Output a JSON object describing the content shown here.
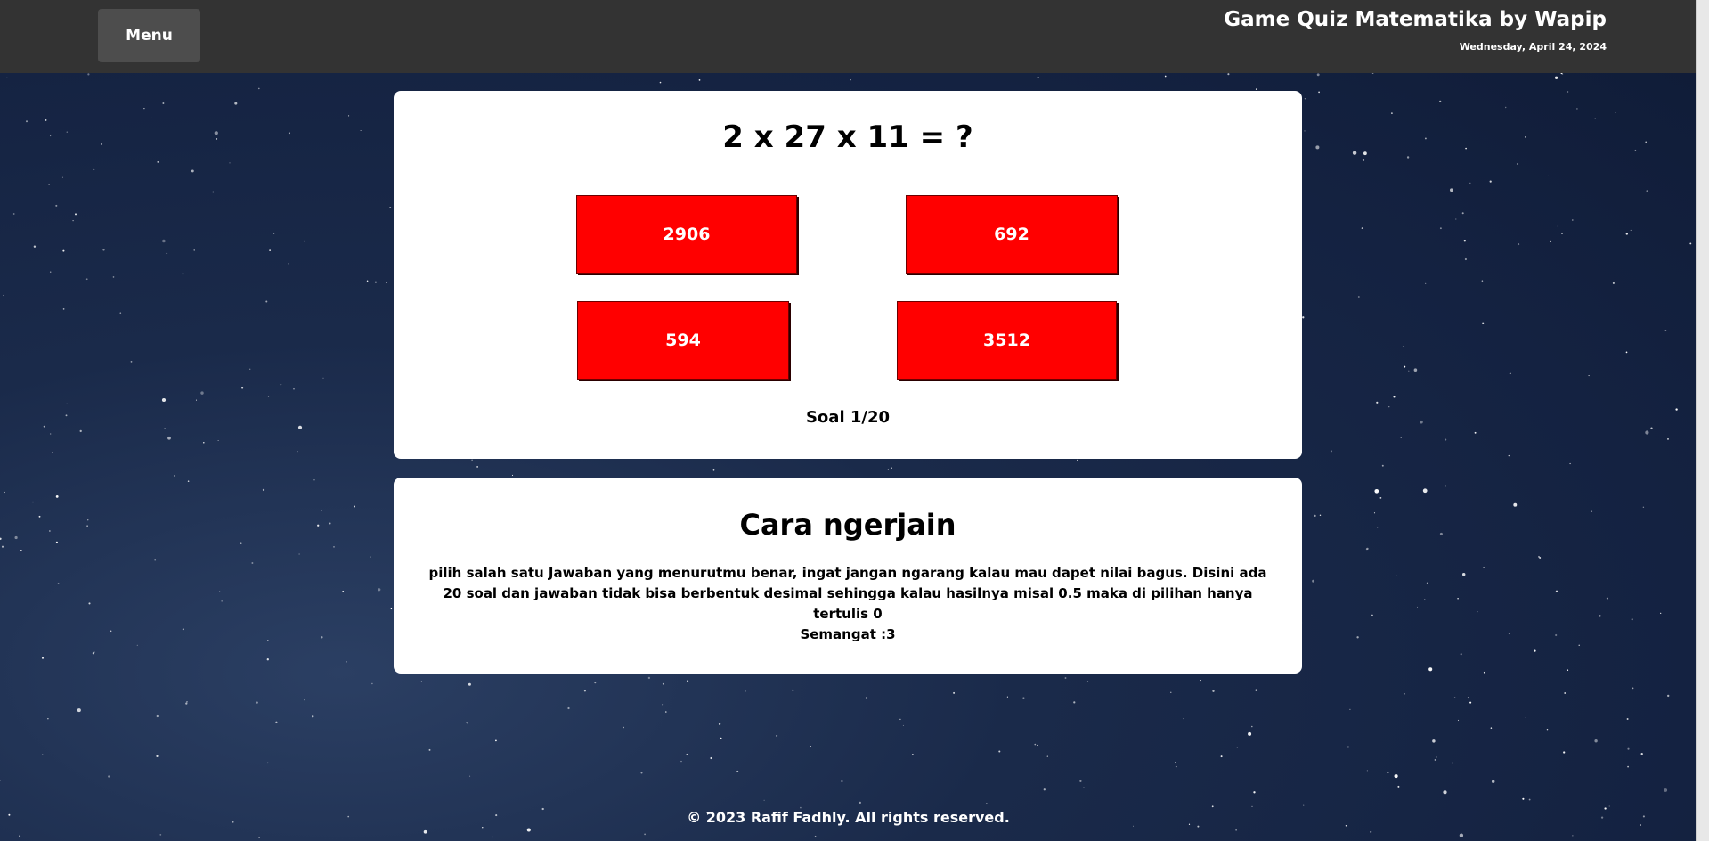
{
  "header": {
    "menu_label": "Menu",
    "title": "Game Quiz Matematika by Wapip",
    "date": "Wednesday, April 24, 2024"
  },
  "quiz": {
    "question": "2 x 27 x 11 = ?",
    "answers": [
      "2906",
      "692",
      "594",
      "3512"
    ],
    "progress": "Soal 1/20"
  },
  "instructions": {
    "title": "Cara ngerjain",
    "text": "pilih salah satu Jawaban yang menurutmu benar, ingat jangan ngarang kalau mau dapet nilai bagus. Disini ada 20 soal dan jawaban tidak bisa berbentuk desimal sehingga kalau hasilnya misal 0.5 maka di pilihan hanya tertulis 0",
    "cheer": "Semangat :3"
  },
  "footer": {
    "copyright": "© 2023 Rafif Fadhly. All rights reserved."
  },
  "colors": {
    "topbar": "#333333",
    "menu_button": "#4d4d4d",
    "answer_button": "#ff0000",
    "background": "#142241"
  }
}
